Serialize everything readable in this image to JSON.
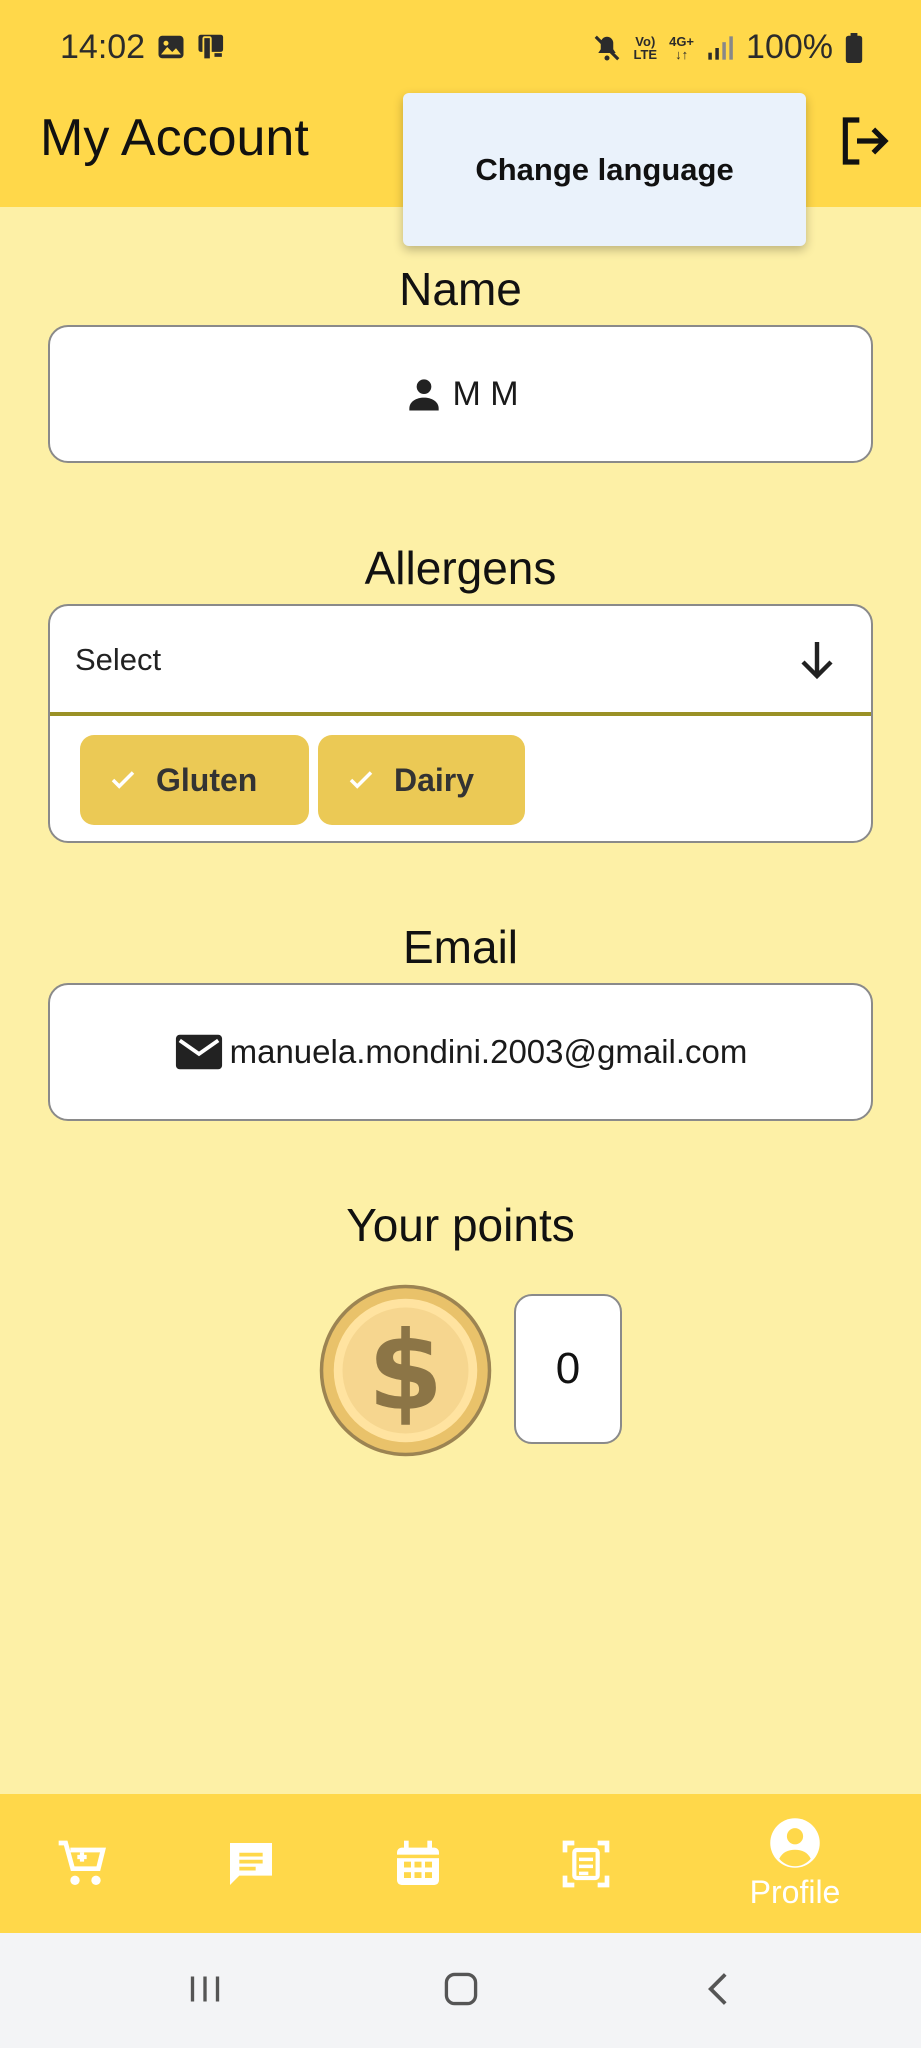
{
  "status_bar": {
    "time": "14:02",
    "net_top": "Vo)",
    "net_bottom": "LTE",
    "net2_top": "4G+",
    "battery": "100%"
  },
  "app_bar": {
    "title": "My Account"
  },
  "popup_menu": {
    "item": "Change language"
  },
  "name_section": {
    "label": "Name",
    "value": "M M"
  },
  "allergens_section": {
    "label": "Allergens",
    "select_placeholder": "Select",
    "chips": [
      "Gluten",
      "Dairy"
    ]
  },
  "email_section": {
    "label": "Email",
    "value": "manuela.mondini.2003@gmail.com"
  },
  "points_section": {
    "label": "Your points",
    "value": "0"
  },
  "bottom_nav": {
    "profile_label": "Profile"
  },
  "icons": [
    "image-icon",
    "device-icon",
    "mute-icon",
    "signal-icon",
    "battery-icon",
    "logout-icon",
    "person-icon",
    "arrow-down-icon",
    "check-icon",
    "mail-icon",
    "coin-icon",
    "cart-icon",
    "chat-icon",
    "calendar-icon",
    "scan-icon",
    "profile-icon",
    "recent-apps-icon",
    "home-icon",
    "back-icon"
  ],
  "colors": {
    "app_bar": "#FFD84A",
    "background": "#FDF0A6",
    "chip": "#EBC955",
    "underline": "#9A9126",
    "menu": "#EAF2FB"
  }
}
